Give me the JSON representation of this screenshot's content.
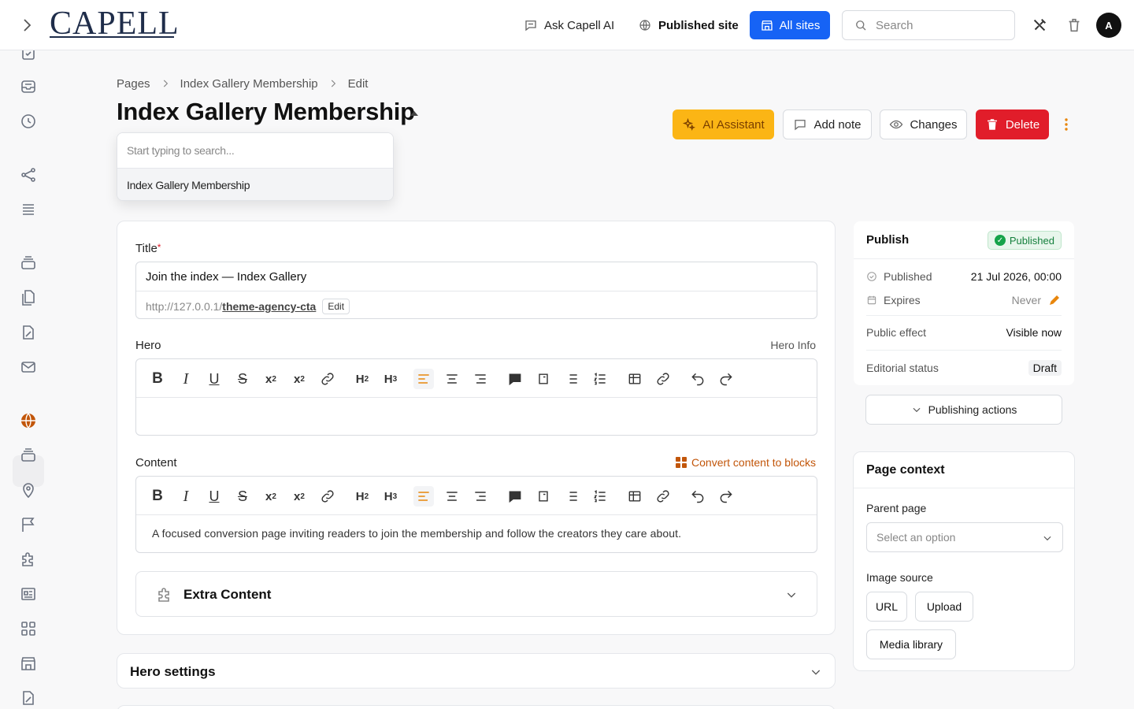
{
  "topbar": {
    "logo": "CAPELL",
    "ask_ai": "Ask Capell AI",
    "published_site": "Published site",
    "all_sites": "All sites",
    "search_placeholder": "Search",
    "avatar_initial": "A"
  },
  "breadcrumb": [
    "Pages",
    "Index Gallery Membership",
    "Edit"
  ],
  "page_title": "Index Gallery Membership",
  "page_switcher": {
    "search_placeholder": "Start typing to search...",
    "options": [
      "Index Gallery Membership"
    ]
  },
  "actions": {
    "ai_assistant": "AI Assistant",
    "add_note": "Add note",
    "changes": "Changes",
    "delete": "Delete"
  },
  "form": {
    "title_label": "Title",
    "required_mark": "*",
    "title_value": "Join the index — Index Gallery",
    "permalink_base": "http://127.0.0.1/",
    "permalink_slug": "theme-agency-cta",
    "permalink_edit": "Edit",
    "hero_label": "Hero",
    "hero_hint": "Hero Info",
    "content_label": "Content",
    "convert_blocks": "Convert content to blocks",
    "content_value": "A focused conversion page inviting readers to join the membership and follow the creators they care about.",
    "extra_content": "Extra Content",
    "hero_settings": "Hero settings"
  },
  "publish": {
    "heading": "Publish",
    "status_badge": "Published",
    "published_label": "Published",
    "published_value": "21 Jul 2026, 00:00",
    "expires_label": "Expires",
    "expires_value": "Never",
    "public_effect_label": "Public effect",
    "public_effect_value": "Visible now",
    "editorial_label": "Editorial status",
    "editorial_value": "Draft",
    "actions_button": "Publishing actions"
  },
  "context": {
    "heading": "Page context",
    "parent_label": "Parent page",
    "parent_placeholder": "Select an option",
    "image_label": "Image source",
    "url_button": "URL",
    "upload_button": "Upload",
    "media_button": "Media library"
  },
  "colors": {
    "primary": "#1663f5",
    "ai": "#fbb515",
    "danger": "#e11d2a",
    "accent": "#e8860c",
    "success": "#16a34a"
  }
}
